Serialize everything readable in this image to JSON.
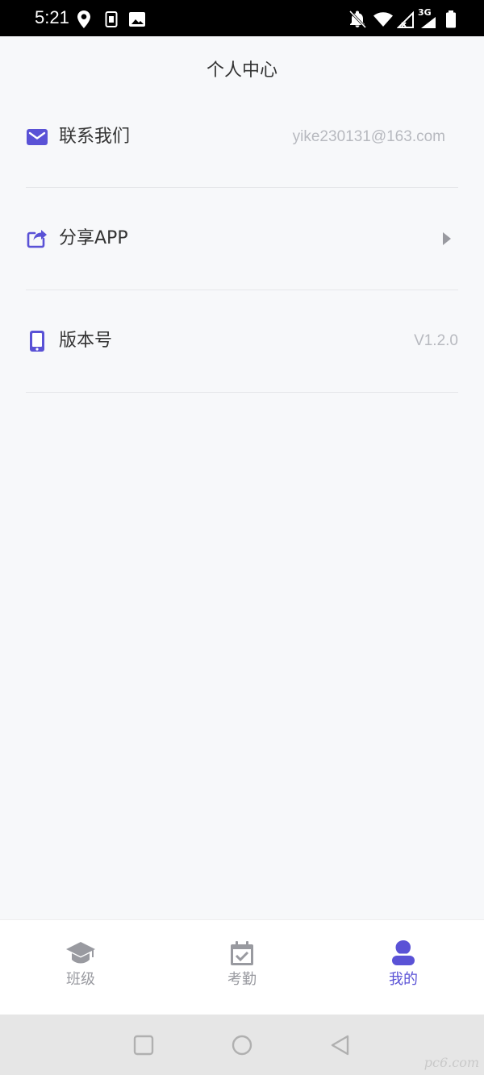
{
  "status_bar": {
    "time": "5:21",
    "network_label": "3G",
    "icons": [
      "location-icon",
      "sim-icon",
      "image-icon",
      "bell-off-icon",
      "wifi-icon",
      "signal-icon",
      "battery-icon"
    ]
  },
  "header": {
    "title": "个人中心"
  },
  "menu": {
    "contact": {
      "icon": "mail-icon",
      "label": "联系我们",
      "value": "yike230131@163.com"
    },
    "share": {
      "icon": "share-icon",
      "label": "分享APP",
      "chevron": "chevron-right-icon"
    },
    "version": {
      "icon": "phone-icon",
      "label": "版本号",
      "value": "V1.2.0"
    }
  },
  "tabs": [
    {
      "label": "班级",
      "icon": "graduation-cap-icon",
      "active": false
    },
    {
      "label": "考勤",
      "icon": "calendar-check-icon",
      "active": false
    },
    {
      "label": "我的",
      "icon": "person-icon",
      "active": true
    }
  ],
  "nav_bar": {
    "buttons": [
      "recent-apps-icon",
      "home-icon",
      "back-icon"
    ]
  },
  "watermark": "pc6.com",
  "colors": {
    "accent": "#5a52d6",
    "background": "#f7f8fa",
    "muted_text": "#b7b9bf",
    "tab_inactive": "#999aa0",
    "status_bar": "#000000",
    "nav_bar": "#e6e6e6"
  }
}
